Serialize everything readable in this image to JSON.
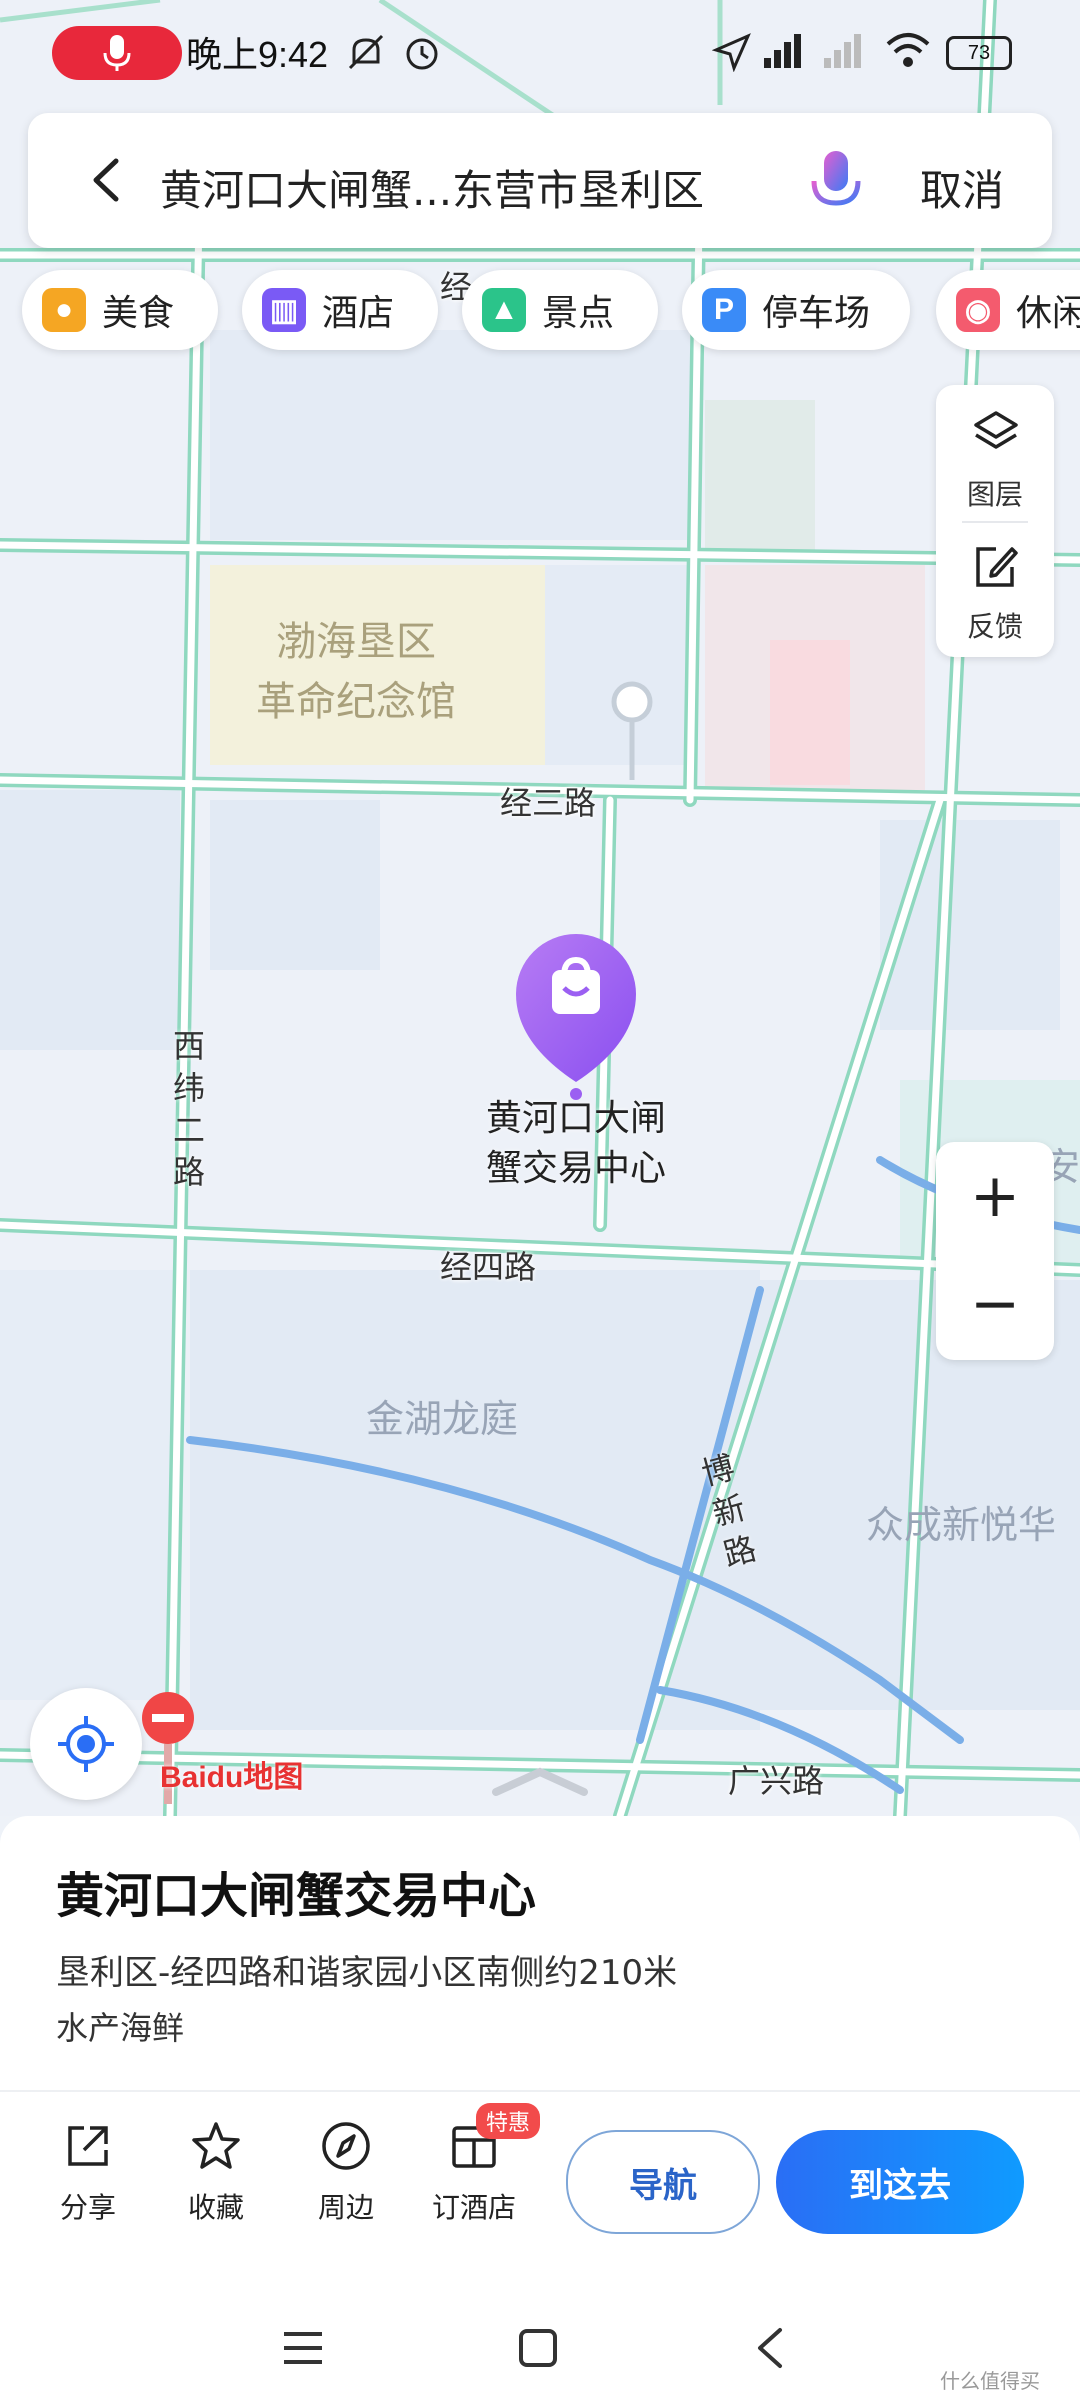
{
  "status": {
    "time": "晚上9:42",
    "battery": "73"
  },
  "search": {
    "query": "黄河口大闸蟹...东营市垦利区",
    "cancel_label": "取消"
  },
  "categories": [
    {
      "label": "美食",
      "icon": "food-icon",
      "color": "#f5a623"
    },
    {
      "label": "酒店",
      "icon": "hotel-icon",
      "color": "#7a5af5"
    },
    {
      "label": "景点",
      "icon": "scenic-icon",
      "color": "#2bc48a"
    },
    {
      "label": "停车场",
      "icon": "parking-icon",
      "color": "#3a8bf7"
    },
    {
      "label": "休闲",
      "icon": "leisure-icon",
      "color": "#f45b6e"
    }
  ],
  "tools": {
    "layers_label": "图层",
    "feedback_label": "反馈"
  },
  "map": {
    "roads": {
      "jing_er": "经",
      "jing_san": "经三路",
      "jing_si": "经四路",
      "xi_wei_er": "西纬二路",
      "bo_xin": "博新路",
      "guang_xing": "广兴路"
    },
    "areas": {
      "memorial_line1": "渤海垦区",
      "memorial_line2": "革命纪念馆",
      "jinhu": "金湖龙庭",
      "zhongcheng": "众成新悦华",
      "yongan": "永安"
    },
    "poi": {
      "line1": "黄河口大闸",
      "line2": "蟹交易中心"
    },
    "logo_text": "Baidu地图"
  },
  "place": {
    "title": "黄河口大闸蟹交易中心",
    "address": "垦利区-经四路和谐家园小区南侧约210米",
    "category": "水产海鲜"
  },
  "actions": {
    "share": "分享",
    "favorite": "收藏",
    "nearby": "周边",
    "book_hotel": "订酒店",
    "badge": "特惠",
    "navigate": "导航",
    "go_here": "到这去"
  },
  "watermark": "什么值得买"
}
